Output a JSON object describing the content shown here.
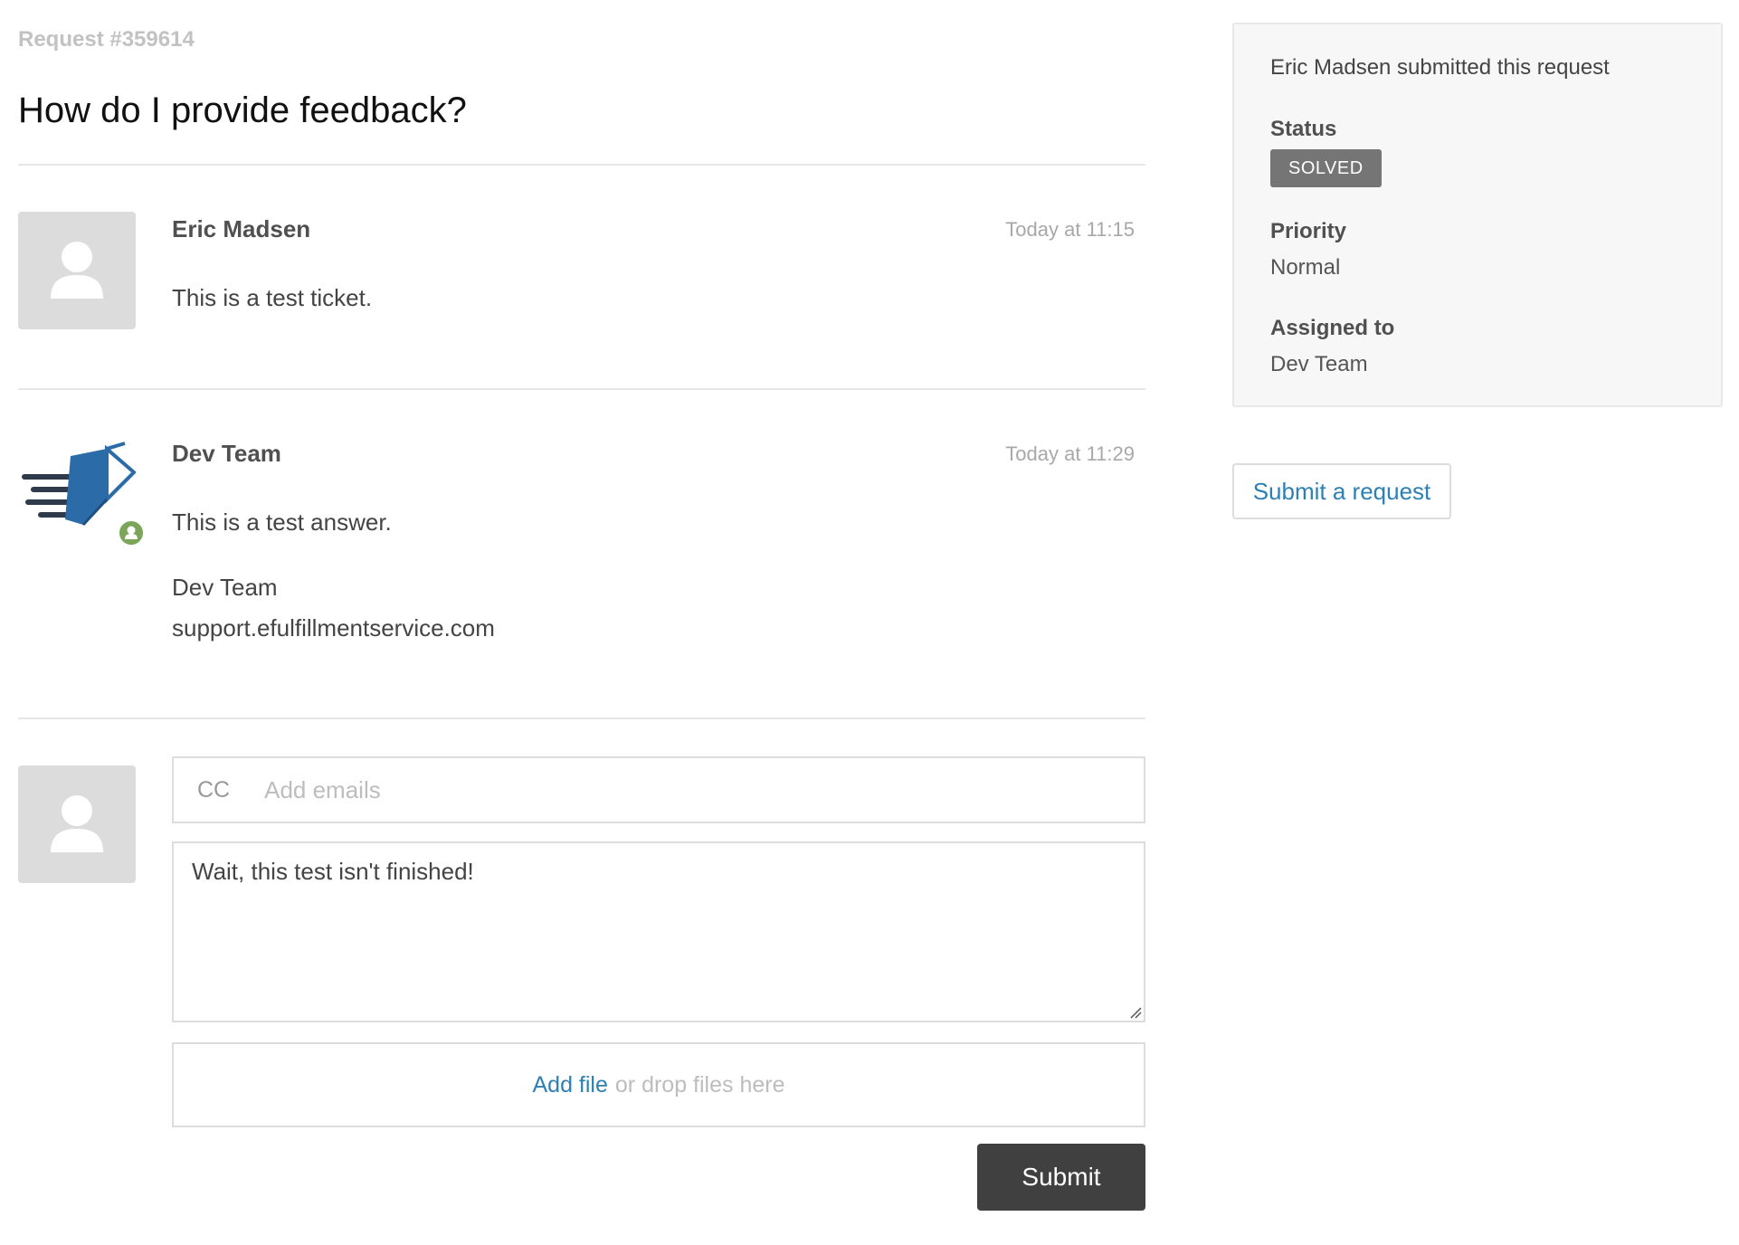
{
  "request": {
    "number": "Request #359614",
    "title": "How do I provide feedback?"
  },
  "comments": [
    {
      "author": "Eric Madsen",
      "timestamp": "Today at 11:15",
      "body": "This is a test ticket."
    },
    {
      "author": "Dev Team",
      "timestamp": "Today at 11:29",
      "body": "This is a test answer.",
      "signature_name": "Dev Team",
      "signature_url": "support.efulfillmentservice.com"
    }
  ],
  "reply": {
    "cc_label": "CC",
    "cc_placeholder": "Add emails",
    "text": "Wait, this test isn't finished!",
    "add_file_label": "Add file",
    "drop_hint": "or drop files here",
    "submit_label": "Submit"
  },
  "sidebar": {
    "submitted_by": "Eric Madsen submitted this request",
    "status_label": "Status",
    "status_value": "SOLVED",
    "priority_label": "Priority",
    "priority_value": "Normal",
    "assigned_label": "Assigned to",
    "assigned_value": "Dev Team",
    "submit_request_label": "Submit a request"
  },
  "colors": {
    "link": "#2d7fb4",
    "status_badge": "#757575",
    "submit_button": "#404040",
    "agent_badge": "#7ba65a",
    "logo_blue": "#2b6ca8"
  },
  "icons": {
    "user_avatar": "user-silhouette-icon",
    "agent_logo": "shipping-box-logo-icon",
    "agent_badge": "agent-person-icon",
    "textarea_resize": "resize-grip-icon"
  }
}
